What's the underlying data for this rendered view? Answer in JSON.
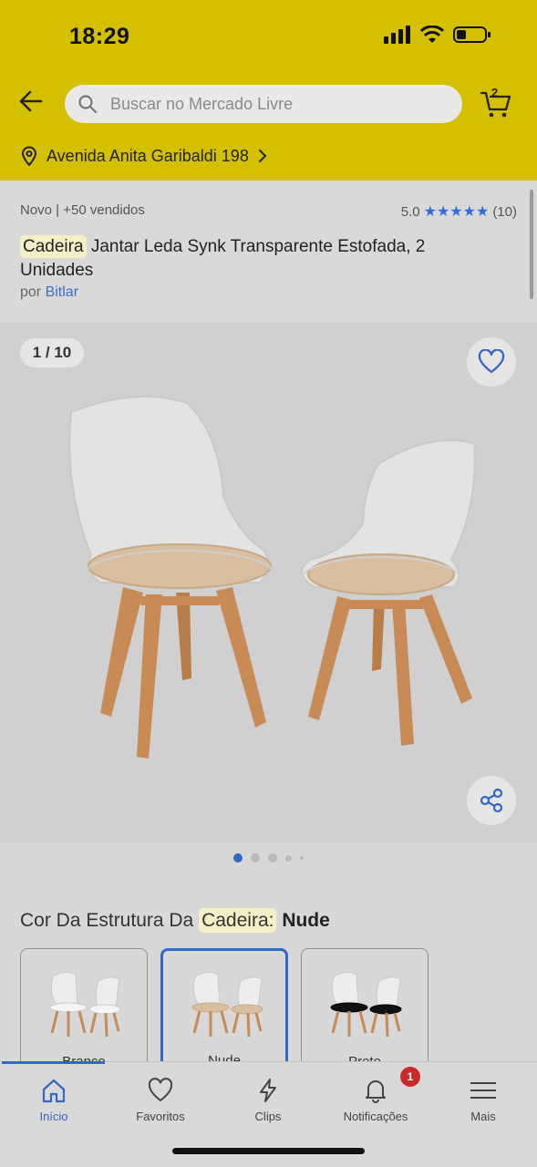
{
  "status_bar": {
    "time": "18:29"
  },
  "header": {
    "search_placeholder": "Buscar no Mercado Livre",
    "cart_count": "2",
    "address": "Avenida Anita Garibaldi 198"
  },
  "product": {
    "condition": "Novo  |  +50 vendidos",
    "rating_value": "5.0",
    "stars": "★★★★★",
    "rating_count": "(10)",
    "title_highlight": "Cadeira",
    "title_rest": " Jantar Leda Synk Transparente Estofada, 2 Unidades",
    "seller_prefix": "por ",
    "seller_name": "Bitlar"
  },
  "gallery": {
    "counter": "1 / 10",
    "active_dot": 0
  },
  "variations": {
    "label_prefix": "Cor Da Estrutura Da ",
    "label_highlight": "Cadeira:",
    "selected_value": "Nude",
    "options": [
      "Branco",
      "Nude",
      "Preto"
    ]
  },
  "bottom_nav": {
    "items": [
      {
        "label": "Início"
      },
      {
        "label": "Favoritos"
      },
      {
        "label": "Clips"
      },
      {
        "label": "Notificações"
      },
      {
        "label": "Mais"
      }
    ],
    "notification_badge": "1"
  },
  "colors": {
    "header_bg": "#d4c000",
    "accent": "#3466c4",
    "badge": "#c92b2b"
  }
}
